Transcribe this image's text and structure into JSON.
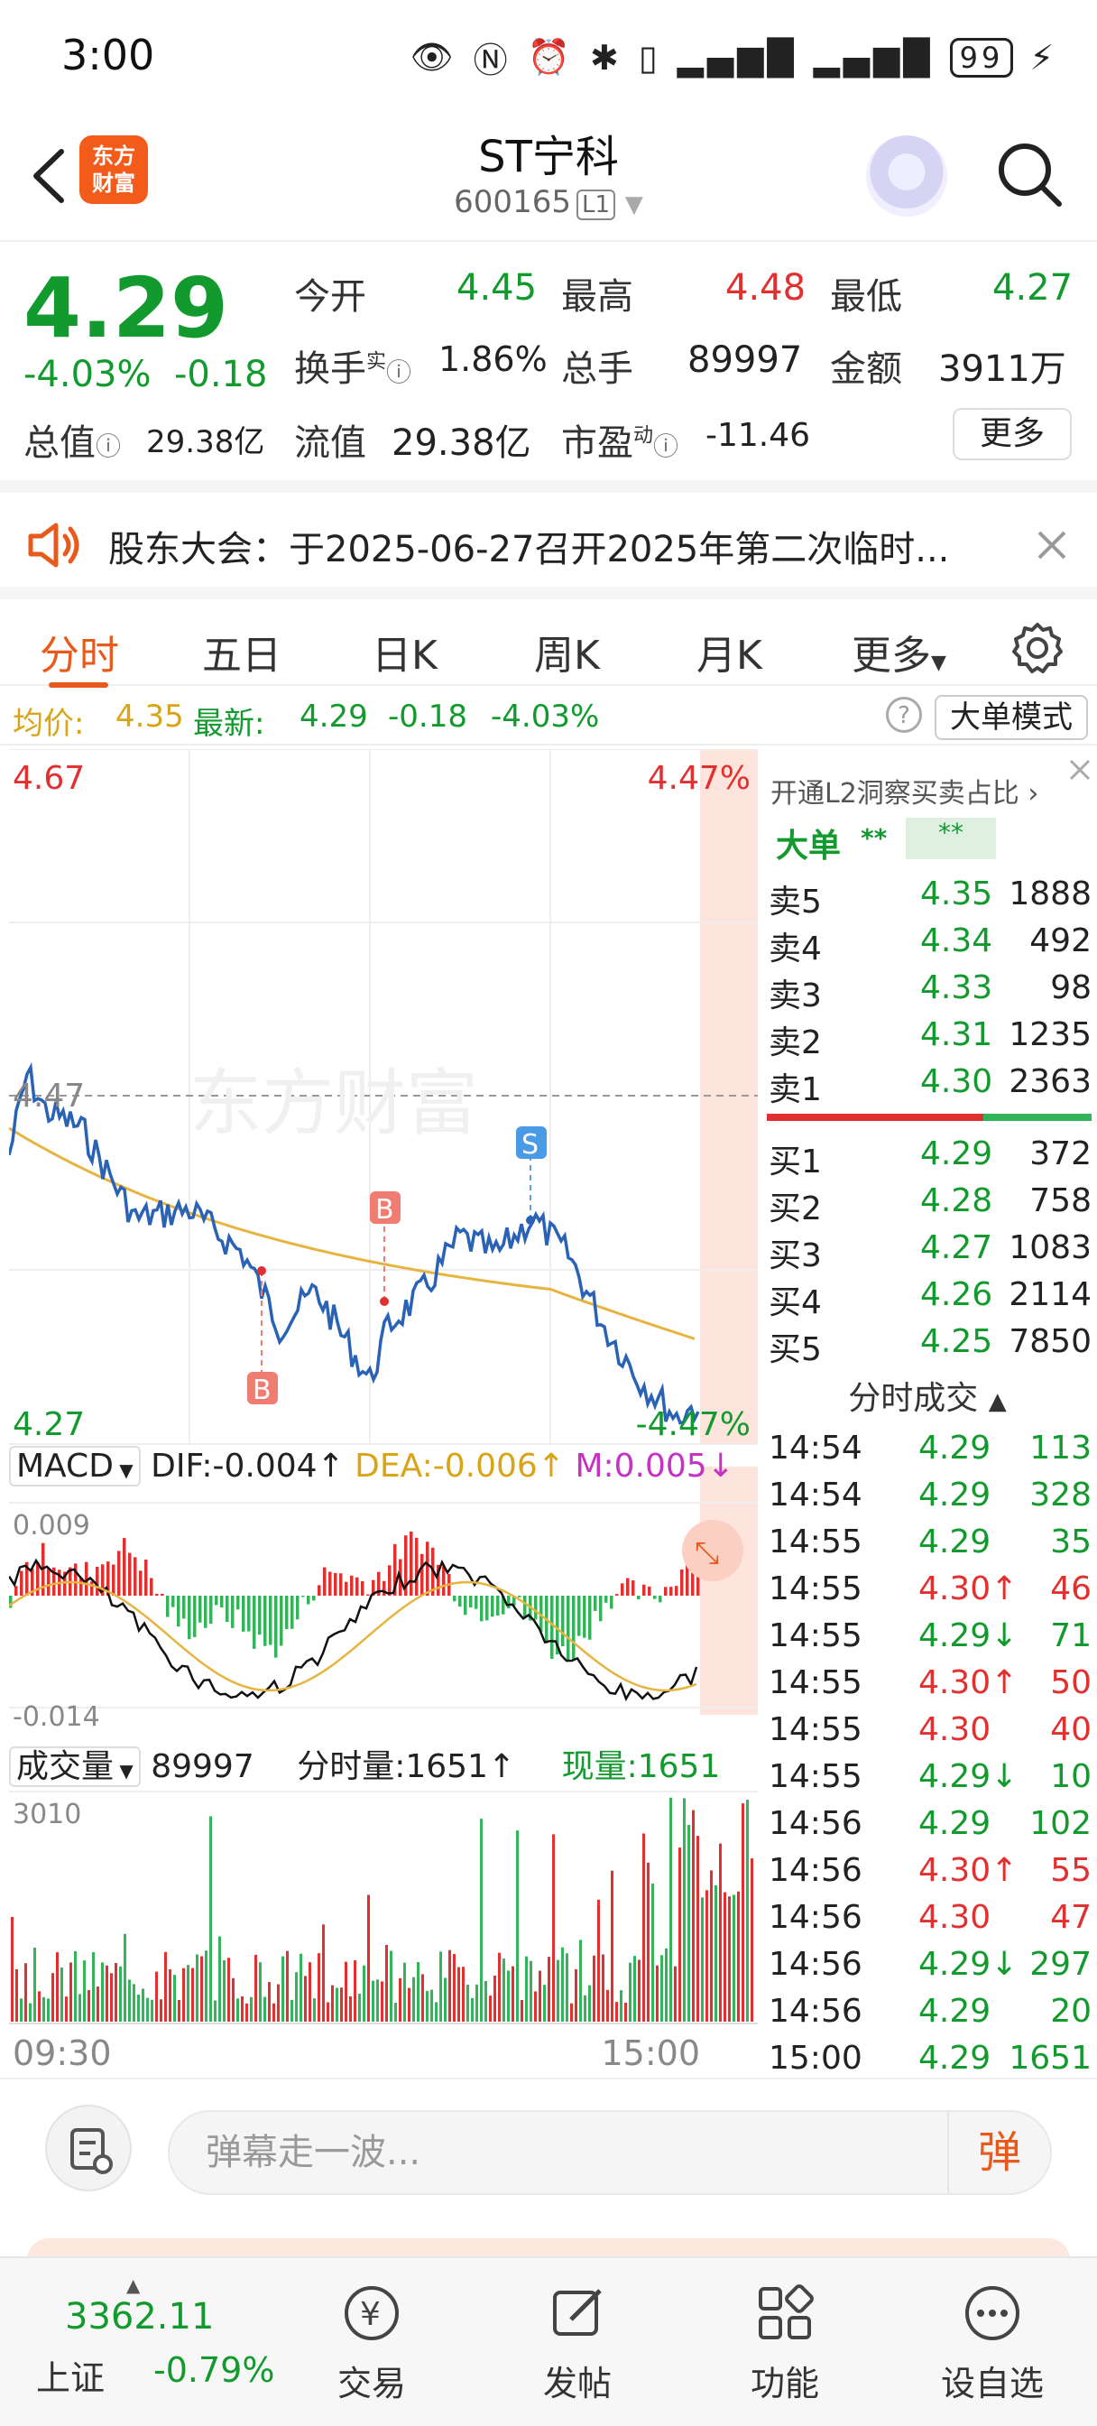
{
  "status_bar": {
    "time": "3:00",
    "battery": "99"
  },
  "header": {
    "logo_text_1": "东方",
    "logo_text_2": "财富",
    "name": "ST宁科",
    "code": "600165",
    "level": "L1"
  },
  "quote": {
    "price": "4.29",
    "change_pct": "-4.03%",
    "change": "-0.18",
    "open_label": "今开",
    "open": "4.45",
    "high_label": "最高",
    "high": "4.48",
    "low_label": "最低",
    "low": "4.27",
    "turnover_label": "换手",
    "turnover_sup": "实",
    "turnover": "1.86%",
    "volume_label": "总手",
    "volume": "89997",
    "amount_label": "金额",
    "amount": "3911万",
    "mktcap_label": "总值",
    "mktcap": "29.38亿",
    "float_label": "流值",
    "float_cap": "29.38亿",
    "pe_label": "市盈",
    "pe_sup": "动",
    "pe": "-11.46",
    "more_button": "更多"
  },
  "notice": {
    "text": "股东大会：于2025-06-27召开2025年第二次临时..."
  },
  "tabs": [
    "分时",
    "五日",
    "日K",
    "周K",
    "月K",
    "更多"
  ],
  "avg_row": {
    "avg_label": "均价:",
    "avg": "4.35",
    "latest_label": "最新:",
    "latest": "4.29",
    "change": "-0.18",
    "change_pct": "-4.03%",
    "help_icon": "?",
    "bigorder_button": "大单模式"
  },
  "chart": {
    "y_top": "4.67",
    "y_mid": "4.47",
    "y_bottom": "4.27",
    "pct_top": "4.47%",
    "pct_bottom": "-4.47%",
    "watermark": "东方财富",
    "marker_b": "B",
    "marker_s": "S",
    "x_start": "09:30",
    "x_end": "15:00"
  },
  "macd": {
    "label": "MACD",
    "dif": "DIF:-0.004↑",
    "dea": "DEA:-0.006↑",
    "m": "M:0.005↓",
    "y_top": "0.009",
    "y_bottom": "-0.014"
  },
  "vol": {
    "label": "成交量",
    "total": "89997",
    "minute_vol": "分时量:1651↑",
    "now_vol": "现量:1651",
    "y_top": "3010"
  },
  "orderbook": {
    "promo": "开通L2洞察买卖占比",
    "bigorder_label": "大单",
    "masked": "**",
    "asks": [
      {
        "label": "卖5",
        "price": "4.35",
        "vol": "1888"
      },
      {
        "label": "卖4",
        "price": "4.34",
        "vol": "492"
      },
      {
        "label": "卖3",
        "price": "4.33",
        "vol": "98"
      },
      {
        "label": "卖2",
        "price": "4.31",
        "vol": "1235"
      },
      {
        "label": "卖1",
        "price": "4.30",
        "vol": "2363"
      }
    ],
    "bids": [
      {
        "label": "买1",
        "price": "4.29",
        "vol": "372"
      },
      {
        "label": "买2",
        "price": "4.28",
        "vol": "758"
      },
      {
        "label": "买3",
        "price": "4.27",
        "vol": "1083"
      },
      {
        "label": "买4",
        "price": "4.26",
        "vol": "2114"
      },
      {
        "label": "买5",
        "price": "4.25",
        "vol": "7850"
      }
    ]
  },
  "trades": {
    "title": "分时成交",
    "rows": [
      {
        "time": "14:54",
        "price": "4.29",
        "vol": "113",
        "color": "green"
      },
      {
        "time": "14:54",
        "price": "4.29",
        "vol": "328",
        "color": "green"
      },
      {
        "time": "14:55",
        "price": "4.29",
        "vol": "35",
        "color": "green"
      },
      {
        "time": "14:55",
        "price": "4.30↑",
        "vol": "46",
        "color": "red"
      },
      {
        "time": "14:55",
        "price": "4.29↓",
        "vol": "71",
        "color": "green"
      },
      {
        "time": "14:55",
        "price": "4.30↑",
        "vol": "50",
        "color": "red"
      },
      {
        "time": "14:55",
        "price": "4.30",
        "vol": "40",
        "color": "red"
      },
      {
        "time": "14:55",
        "price": "4.29↓",
        "vol": "10",
        "color": "green"
      },
      {
        "time": "14:56",
        "price": "4.29",
        "vol": "102",
        "color": "green"
      },
      {
        "time": "14:56",
        "price": "4.30↑",
        "vol": "55",
        "color": "red"
      },
      {
        "time": "14:56",
        "price": "4.30",
        "vol": "47",
        "color": "red"
      },
      {
        "time": "14:56",
        "price": "4.29↓",
        "vol": "297",
        "color": "green"
      },
      {
        "time": "14:56",
        "price": "4.29",
        "vol": "20",
        "color": "green"
      },
      {
        "time": "15:00",
        "price": "4.29",
        "vol": "1651",
        "color": "green"
      }
    ]
  },
  "comment": {
    "placeholder": "弹幕走一波...",
    "danmu_button": "弹"
  },
  "bottom_nav": {
    "index_value": "3362.11",
    "index_name": "上证",
    "index_change": "-0.79%",
    "items": [
      "交易",
      "发帖",
      "功能",
      "设自选"
    ]
  },
  "colors": {
    "up": "#e0302f",
    "down": "#139a2e",
    "accent": "#e85a1b",
    "avg_line": "#e6b440",
    "price_line": "#2a63b5"
  }
}
